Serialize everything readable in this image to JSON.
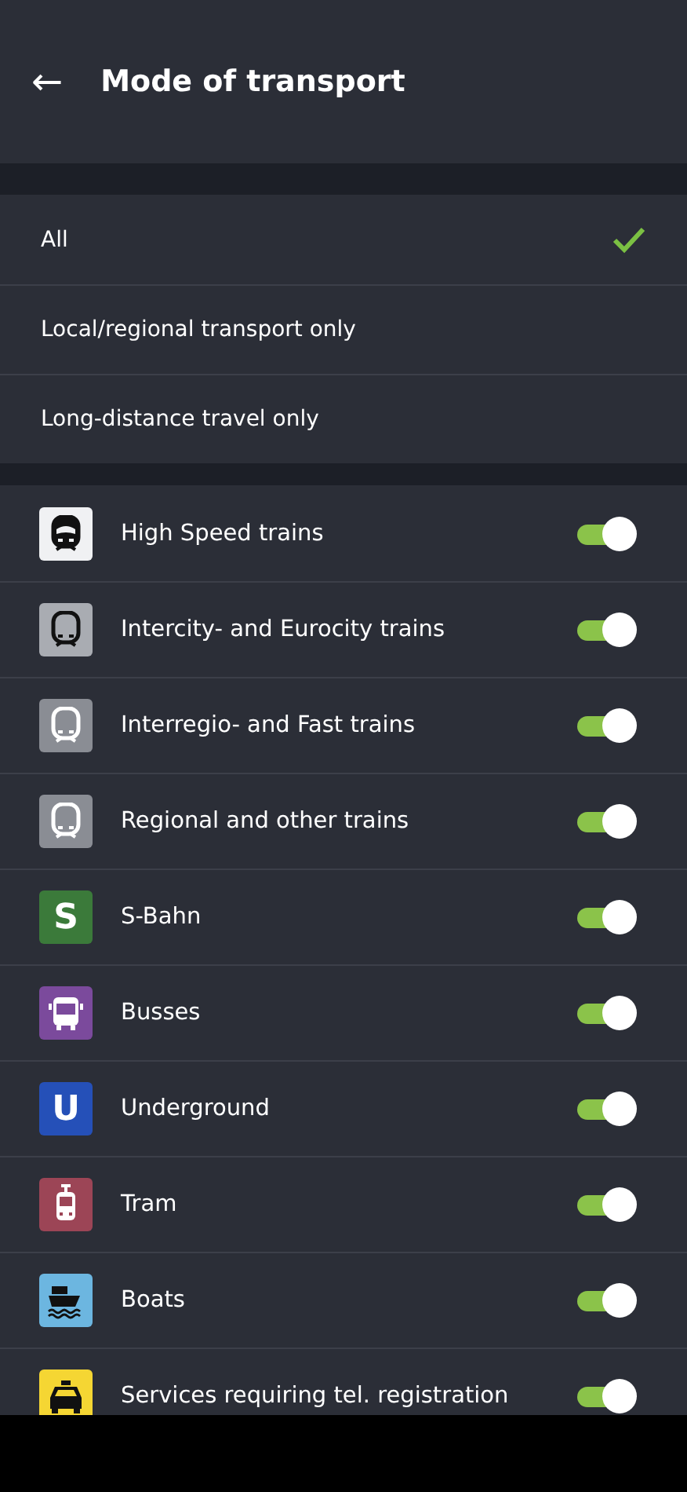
{
  "header": {
    "back_icon": "←",
    "title": "Mode of transport"
  },
  "scope_options": [
    {
      "label": "All",
      "selected": true
    },
    {
      "label": "Local/regional transport only",
      "selected": false
    },
    {
      "label": "Long-distance travel only",
      "selected": false
    }
  ],
  "modes": [
    {
      "label": "High Speed trains",
      "kind": "highspeed",
      "color": "#f0f1f3",
      "on": true
    },
    {
      "label": "Intercity- and Eurocity trains",
      "kind": "intercity",
      "color": "#a9acb2",
      "on": true
    },
    {
      "label": "Interregio- and Fast trains",
      "kind": "train",
      "color": "#8a8d94",
      "on": true
    },
    {
      "label": "Regional and other trains",
      "kind": "train",
      "color": "#8a8d94",
      "on": true
    },
    {
      "label": "S-Bahn",
      "kind": "letter",
      "badge": "S",
      "color": "#3b7a3a",
      "on": true
    },
    {
      "label": "Busses",
      "kind": "bus",
      "color": "#7b4a9c",
      "on": true
    },
    {
      "label": "Underground",
      "kind": "letter",
      "badge": "U",
      "color": "#2550b8",
      "on": true
    },
    {
      "label": "Tram",
      "kind": "tram",
      "color": "#9c4556",
      "on": true
    },
    {
      "label": "Boats",
      "kind": "boat",
      "color": "#6cb6e0",
      "on": true
    },
    {
      "label": "Services requiring tel. registration",
      "kind": "taxi",
      "color": "#f5d633",
      "on": true
    }
  ]
}
